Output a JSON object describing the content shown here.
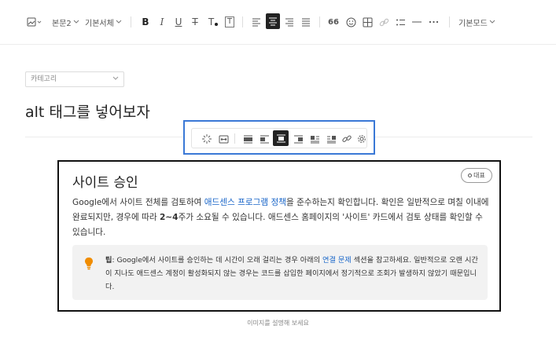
{
  "toolbar": {
    "paragraph_style": "본문2",
    "font_family": "기본서체",
    "bold": "B",
    "italic": "I",
    "underline": "U",
    "strikethrough": "T",
    "text_color": "T",
    "bg_color": "T",
    "quote_label": "66",
    "mode": "기본모드"
  },
  "post": {
    "category_placeholder": "카테고리",
    "title": "alt 태그를 넣어보자"
  },
  "image": {
    "heading": "사이트 승인",
    "badge": "대표",
    "body_1": "Google에서 사이트 전체를 검토하여 ",
    "body_link": "애드센스 프로그램 정책",
    "body_2": "을 준수하는지 확인합니다. 확인은 일반적으로 며칠 이내에 완료되지만, 경우에 따라 ",
    "body_bold": "2~4",
    "body_3": "주가 소요될 수 있습니다. 애드센스 홈페이지의 '사이트' 카드에서 검토 상태를 확인할 수 있습니다.",
    "tip_label": "팁",
    "tip_1": ": Google에서 사이트를 승인하는 데 시간이 오래 걸리는 경우 아래의 ",
    "tip_link": "연결 문제",
    "tip_2": " 섹션을 참고하세요. 일반적으로 오랜 시간이 지나도 애드센스 계정이 활성화되지 않는 경우는 코드를 삽입한 페이지에서 정기적으로 조회가 발생하지 않았기 때문입니다.",
    "caption": "이미지를 설명해 보세요"
  },
  "colors": {
    "link": "#1a66c9",
    "selection_border": "#3a78d6",
    "tip_bulb": "#f08c00"
  }
}
